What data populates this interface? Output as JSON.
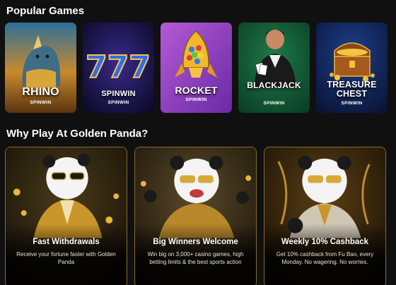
{
  "sections": {
    "popular_title": "Popular Games",
    "why_title": "Why Play At Golden Panda?"
  },
  "games": [
    {
      "title": "RHINO",
      "brand": "SPINWIN",
      "icon": "rhino-icon"
    },
    {
      "title": "SPINWIN",
      "brand": "SPINWIN",
      "icon": "lucky-777-icon"
    },
    {
      "title": "ROCKET",
      "brand": "SPINWIN",
      "icon": "rocket-icon"
    },
    {
      "title": "BLACKJACK",
      "brand": "SPINWIN",
      "icon": "dealer-icon"
    },
    {
      "title": "TREASURE CHEST",
      "brand": "SPINWIN",
      "icon": "treasure-chest-icon"
    }
  ],
  "features": [
    {
      "title": "Fast Withdrawals",
      "desc": "Receive your fortune faster with Golden Panda",
      "icon": "panda-mascot-icon"
    },
    {
      "title": "Big Winners Welcome",
      "desc": "Win big on 3,000+ casino games, high betting limits & the best sports action",
      "icon": "panda-mascot-icon"
    },
    {
      "title": "Weekly 10% Cashback",
      "desc": "Get 10% cashback from Fu Bao, every Monday. No wagering. No worries.",
      "icon": "panda-mascot-icon"
    }
  ],
  "colors": {
    "background": "#101010",
    "gold": "#d8a93a",
    "card_border": "#8a6b2a"
  }
}
